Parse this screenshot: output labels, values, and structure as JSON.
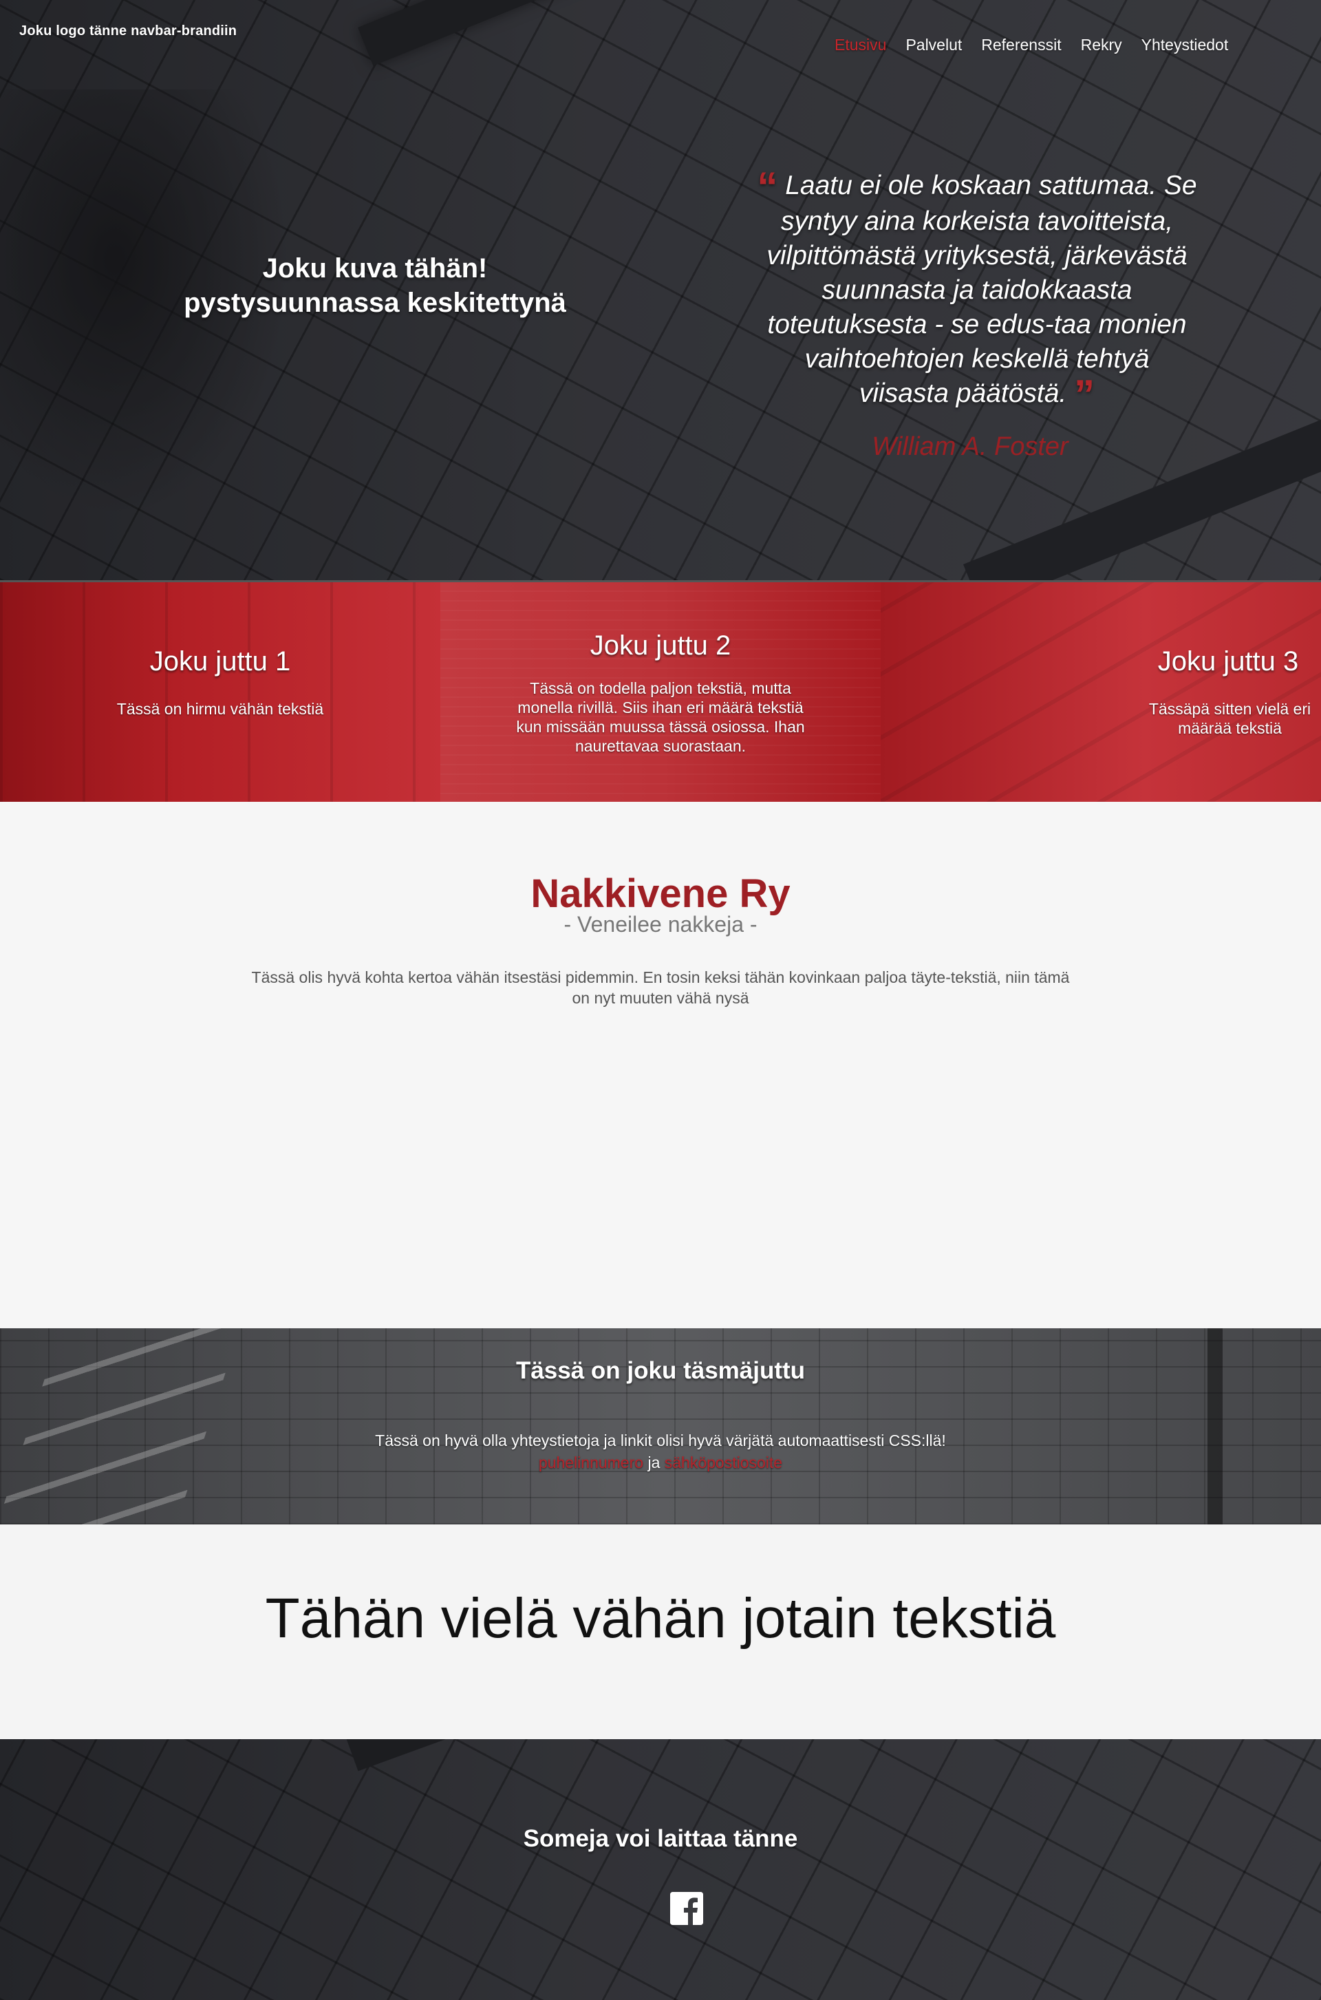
{
  "brand": "Joku logo tänne navbar-brandiin",
  "nav": [
    {
      "label": "Etusivu",
      "active": true
    },
    {
      "label": "Palvelut",
      "active": false
    },
    {
      "label": "Referenssit",
      "active": false
    },
    {
      "label": "Rekry",
      "active": false
    },
    {
      "label": "Yhteystiedot",
      "active": false
    }
  ],
  "hero": {
    "caption_line1": "Joku kuva tähän!",
    "caption_line2": "pystysuunnassa keskitettynä",
    "quote": "Laatu ei ole koskaan sattumaa. Se syntyy aina korkeista tavoitteista, vilpittömästä yrityksestä, järkevästä suunnasta ja taidokkaasta toteutuksesta - se edus-taa monien vaihtoehtojen keskellä tehtyä viisasta päätöstä.",
    "author": "William A. Foster"
  },
  "features": [
    {
      "title": "Joku juttu 1",
      "text": "Tässä on hirmu vähän tekstiä"
    },
    {
      "title": "Joku juttu 2",
      "text": "Tässä on todella paljon tekstiä, mutta monella rivillä. Siis ihan eri määrä tekstiä kun missään muussa tässä osiossa. Ihan naurettavaa suorastaan."
    },
    {
      "title": "Joku juttu 3",
      "text": "Tässäpä sitten vielä eri määrää tekstiä"
    }
  ],
  "about": {
    "title": "Nakkivene Ry",
    "subtitle": "- Veneilee nakkeja -",
    "text": "Tässä olis hyvä kohta kertoa vähän itsestäsi pidemmin. En tosin keksi tähän kovinkaan paljoa täyte-tekstiä, niin tämä on nyt muuten vähä nysä"
  },
  "contact": {
    "title": "Tässä on joku täsmäjuttu",
    "text": "Tässä on hyvä olla yhteystietoja ja linkit olisi hyvä värjätä automaattisesti CSS:llä!",
    "phone_link": "puhelinnumero",
    "and": "ja",
    "email_link": "sähköpostiosoite"
  },
  "tagline": "Tähän vielä vähän jotain tekstiä",
  "footer": {
    "title": "Someja voi laittaa tänne",
    "social_icon": "facebook-icon"
  },
  "colors": {
    "accent": "#c8262b",
    "brand_red": "#9e1f24"
  }
}
